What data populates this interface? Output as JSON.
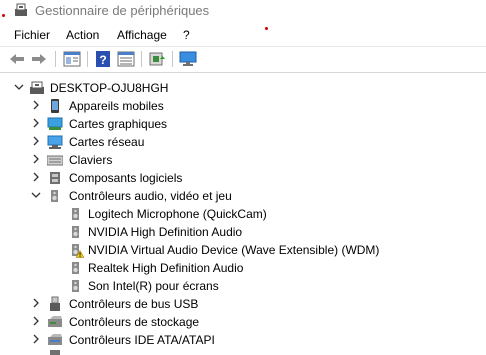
{
  "window": {
    "title": "Gestionnaire de périphériques"
  },
  "menu": {
    "file": "Fichier",
    "action": "Action",
    "view": "Affichage",
    "help": "?"
  },
  "toolbar": {
    "buttons": [
      "back-icon",
      "forward-icon",
      "properties-panel-icon",
      "help-icon",
      "list-view-icon",
      "update-driver-icon",
      "monitor-icon"
    ]
  },
  "tree": {
    "root": "DESKTOP-OJU8HGH",
    "categories": [
      {
        "label": "Appareils mobiles",
        "icon": "mobile-device-icon",
        "expanded": false
      },
      {
        "label": "Cartes graphiques",
        "icon": "display-adapter-icon",
        "expanded": false
      },
      {
        "label": "Cartes réseau",
        "icon": "network-adapter-icon",
        "expanded": false
      },
      {
        "label": "Claviers",
        "icon": "keyboard-icon",
        "expanded": false
      },
      {
        "label": "Composants logiciels",
        "icon": "software-component-icon",
        "expanded": false
      },
      {
        "label": "Contrôleurs audio, vidéo et jeu",
        "icon": "speaker-icon",
        "expanded": true
      },
      {
        "label": "Contrôleurs de bus USB",
        "icon": "usb-icon",
        "expanded": false
      },
      {
        "label": "Contrôleurs de stockage",
        "icon": "storage-controller-icon",
        "expanded": false
      },
      {
        "label": "Contrôleurs IDE ATA/ATAPI",
        "icon": "ide-controller-icon",
        "expanded": false
      }
    ],
    "audio_children": [
      {
        "label": "Logitech Microphone (QuickCam)",
        "icon": "speaker-icon",
        "warning": false
      },
      {
        "label": "NVIDIA High Definition Audio",
        "icon": "speaker-icon",
        "warning": false
      },
      {
        "label": "NVIDIA Virtual Audio Device (Wave Extensible) (WDM)",
        "icon": "speaker-icon",
        "warning": true
      },
      {
        "label": "Realtek High Definition Audio",
        "icon": "speaker-icon",
        "warning": false
      },
      {
        "label": "Son Intel(R) pour écrans",
        "icon": "speaker-icon",
        "warning": false
      }
    ]
  },
  "colors": {
    "accent": "#1e6fd9",
    "warning": "#f2c511",
    "title_text": "#7a7a7a"
  }
}
